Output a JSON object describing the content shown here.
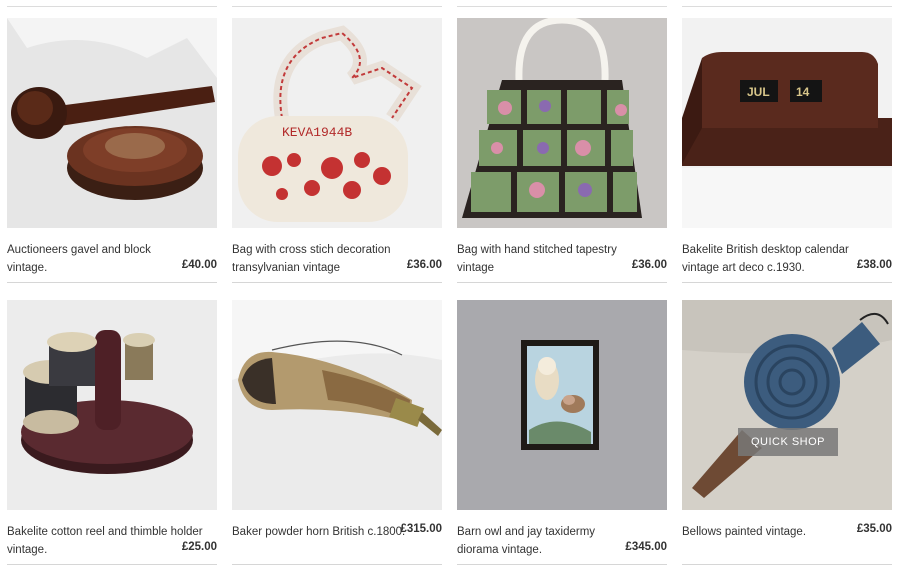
{
  "products": [
    {
      "title": "Auctioneers gavel and block vintage.",
      "price": "£40.00"
    },
    {
      "title": "Bag with cross stich decoration transylvanian vintage",
      "price": "£36.00"
    },
    {
      "title": "Bag with hand stitched tapestry vintage",
      "price": "£36.00"
    },
    {
      "title": "Bakelite British desktop calendar vintage art deco c.1930.",
      "price": "£38.00"
    },
    {
      "title": "Bakelite cotton reel and thimble holder vintage.",
      "price": "£25.00"
    },
    {
      "title": "Baker powder horn British c.1800.",
      "price": "£315.00"
    },
    {
      "title": "Barn owl and jay taxidermy diorama vintage.",
      "price": "£345.00"
    },
    {
      "title": "Bellows painted vintage.",
      "price": "£35.00"
    }
  ],
  "images": {
    "bag_text": "KEVA1944B",
    "calendar_month": "JUL",
    "calendar_day": "14"
  },
  "quick_shop_label": "QUICK SHOP"
}
